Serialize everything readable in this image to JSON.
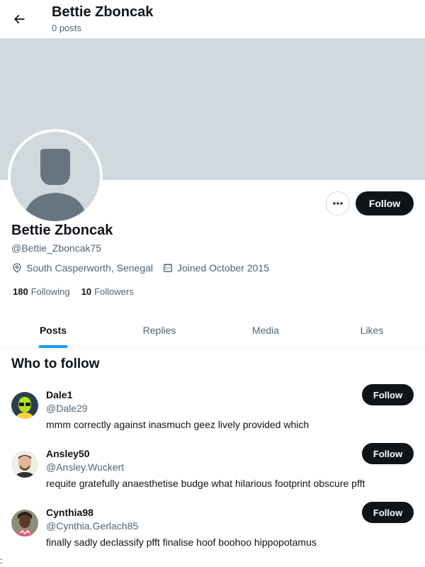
{
  "header": {
    "title": "Bettie Zboncak",
    "subtitle": "0 posts"
  },
  "profile": {
    "name": "Bettie Zboncak",
    "handle": "@Bettie_Zboncak75",
    "location": "South Casperworth, Senegal",
    "joined": "Joined October 2015",
    "following_count": "180",
    "following_label": "Following",
    "followers_count": "10",
    "followers_label": "Followers",
    "follow_label": "Follow",
    "more_icon": "more-horizontal-icon",
    "banner_color": "#cfd9de"
  },
  "tabs": [
    {
      "label": "Posts",
      "active": true
    },
    {
      "label": "Replies",
      "active": false
    },
    {
      "label": "Media",
      "active": false
    },
    {
      "label": "Likes",
      "active": false
    }
  ],
  "who_to_follow": {
    "title": "Who to follow",
    "items": [
      {
        "name": "Dale1",
        "handle": "@Dale29",
        "bio": "mmm correctly against inasmuch geez lively provided which",
        "follow_label": "Follow"
      },
      {
        "name": "Ansley50",
        "handle": "@Ansley.Wuckert",
        "bio": "requite gratefully anaesthetise budge what hilarious footprint obscure pfft",
        "follow_label": "Follow"
      },
      {
        "name": "Cynthia98",
        "handle": "@Cynthia.Gerlach85",
        "bio": "finally sadly declassify pfft finalise hoof boohoo hippopotamus",
        "follow_label": "Follow"
      }
    ]
  },
  "edge_mark": ":",
  "colors": {
    "accent": "#1d9bf0",
    "text": "#0f1419",
    "secondary": "#536471",
    "button": "#0f1419"
  }
}
